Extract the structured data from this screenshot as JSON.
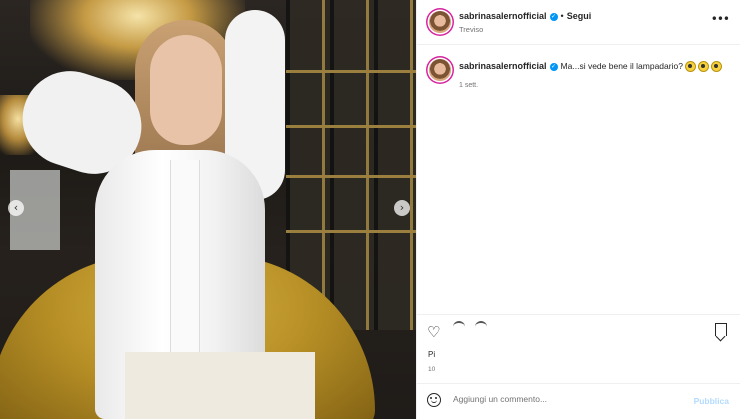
{
  "post": {
    "photo_alt": "",
    "nav_prev": "‹",
    "nav_next": "›"
  },
  "header": {
    "username": "sabrinasalernofficial",
    "verified_mark": "✓",
    "separator": "•",
    "follow_label": "Segui",
    "location": "Treviso",
    "more_icon": "•••"
  },
  "caption": {
    "username": "sabrinasalernofficial",
    "verified_mark": "✓",
    "text": "Ma...si vede bene il lampadario?",
    "emoji_count": 3,
    "time": "1 sett."
  },
  "actions": {
    "like_icon": "♡",
    "likes_text": "Pi",
    "date_text": "10"
  },
  "comment_box": {
    "placeholder": "Aggiungi un commento...",
    "publish_label": "Pubblica"
  },
  "colors": {
    "story_ring": "#d6249f",
    "verified": "#0095f6",
    "publish_disabled": "#b3dbff"
  }
}
